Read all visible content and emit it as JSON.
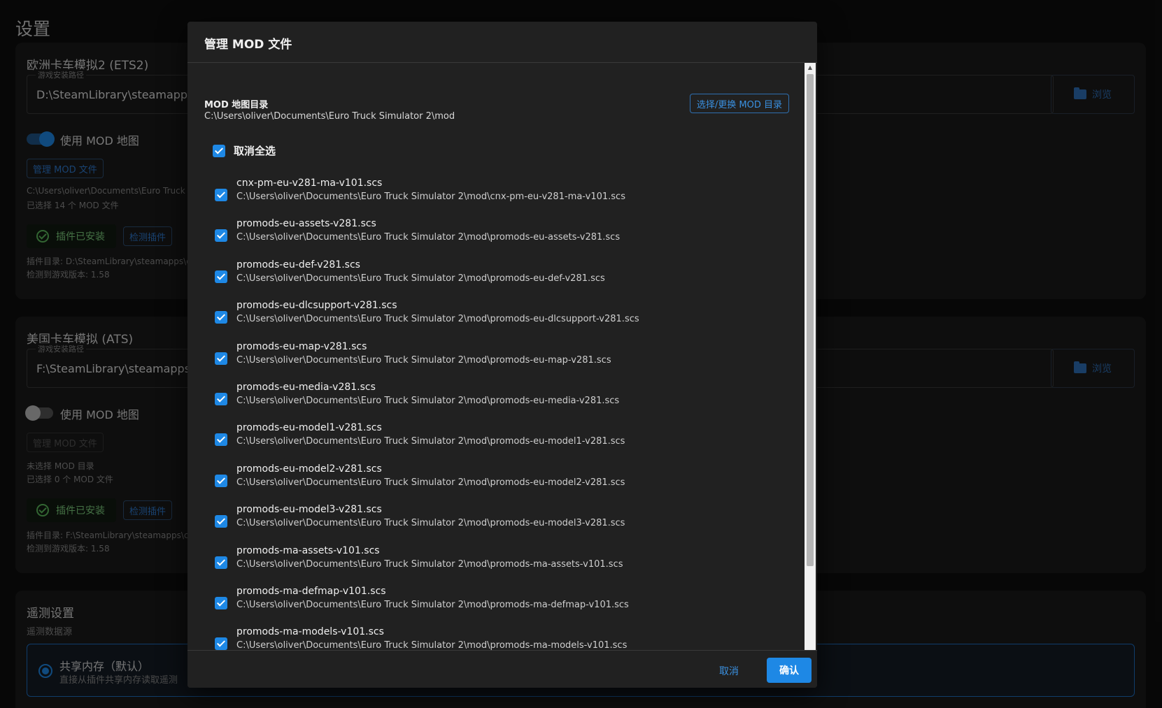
{
  "page": {
    "title": "设置"
  },
  "ets2": {
    "title": "欧洲卡车模拟2 (ETS2)",
    "path_legend": "游戏安装路径",
    "path_value": "D:\\SteamLibrary\\steamapps\\c",
    "browse_label": "浏览",
    "use_mod_label": "使用 MOD 地图",
    "use_mod_enabled": true,
    "manage_mod_label": "管理 MOD 文件",
    "mod_dir_text": "C:\\Users\\oliver\\Documents\\Euro Truck S",
    "selected_count_text": "已选择 14 个 MOD 文件",
    "installed_label": "插件已安装",
    "detect_label": "检测插件",
    "plugin_dir_text": "插件目录: D:\\SteamLibrary\\steamapps\\c",
    "game_version_text": "检测到游戏版本: 1.58"
  },
  "ats": {
    "title": "美国卡车模拟 (ATS)",
    "path_legend": "游戏安装路径",
    "path_value": "F:\\SteamLibrary\\steamapps\\c",
    "browse_label": "浏览",
    "use_mod_label": "使用 MOD 地图",
    "use_mod_enabled": false,
    "manage_mod_label": "管理 MOD 文件",
    "mod_dir_text": "未选择 MOD 目录",
    "selected_count_text": "已选择 0 个 MOD 文件",
    "installed_label": "插件已安装",
    "detect_label": "检测插件",
    "plugin_dir_text": "插件目录: F:\\SteamLibrary\\steamapps\\c",
    "game_version_text": "检测到游戏版本: 1.58"
  },
  "telemetry": {
    "title": "遥测设置",
    "source_label": "遥测数据源",
    "option_title": "共享内存（默认）",
    "option_desc": "直接从插件共享内存读取遥测"
  },
  "dialog": {
    "title": "管理 MOD 文件",
    "dir_label": "MOD 地图目录",
    "dir_value": "C:\\Users\\oliver\\Documents\\Euro Truck Simulator 2\\mod",
    "change_dir_label": "选择/更换 MOD 目录",
    "select_all_label": "取消全选",
    "cancel_label": "取消",
    "confirm_label": "确认",
    "mods": [
      {
        "name": "cnx-pm-eu-v281-ma-v101.scs",
        "path": "C:\\Users\\oliver\\Documents\\Euro Truck Simulator 2\\mod\\cnx-pm-eu-v281-ma-v101.scs"
      },
      {
        "name": "promods-eu-assets-v281.scs",
        "path": "C:\\Users\\oliver\\Documents\\Euro Truck Simulator 2\\mod\\promods-eu-assets-v281.scs"
      },
      {
        "name": "promods-eu-def-v281.scs",
        "path": "C:\\Users\\oliver\\Documents\\Euro Truck Simulator 2\\mod\\promods-eu-def-v281.scs"
      },
      {
        "name": "promods-eu-dlcsupport-v281.scs",
        "path": "C:\\Users\\oliver\\Documents\\Euro Truck Simulator 2\\mod\\promods-eu-dlcsupport-v281.scs"
      },
      {
        "name": "promods-eu-map-v281.scs",
        "path": "C:\\Users\\oliver\\Documents\\Euro Truck Simulator 2\\mod\\promods-eu-map-v281.scs"
      },
      {
        "name": "promods-eu-media-v281.scs",
        "path": "C:\\Users\\oliver\\Documents\\Euro Truck Simulator 2\\mod\\promods-eu-media-v281.scs"
      },
      {
        "name": "promods-eu-model1-v281.scs",
        "path": "C:\\Users\\oliver\\Documents\\Euro Truck Simulator 2\\mod\\promods-eu-model1-v281.scs"
      },
      {
        "name": "promods-eu-model2-v281.scs",
        "path": "C:\\Users\\oliver\\Documents\\Euro Truck Simulator 2\\mod\\promods-eu-model2-v281.scs"
      },
      {
        "name": "promods-eu-model3-v281.scs",
        "path": "C:\\Users\\oliver\\Documents\\Euro Truck Simulator 2\\mod\\promods-eu-model3-v281.scs"
      },
      {
        "name": "promods-ma-assets-v101.scs",
        "path": "C:\\Users\\oliver\\Documents\\Euro Truck Simulator 2\\mod\\promods-ma-assets-v101.scs"
      },
      {
        "name": "promods-ma-defmap-v101.scs",
        "path": "C:\\Users\\oliver\\Documents\\Euro Truck Simulator 2\\mod\\promods-ma-defmap-v101.scs"
      },
      {
        "name": "promods-ma-models-v101.scs",
        "path": "C:\\Users\\oliver\\Documents\\Euro Truck Simulator 2\\mod\\promods-ma-models-v101.scs"
      }
    ]
  },
  "colors": {
    "accent": "#1e88e5",
    "success": "#5cb85c",
    "background": "#0e0e0e",
    "dialog": "#212121"
  }
}
